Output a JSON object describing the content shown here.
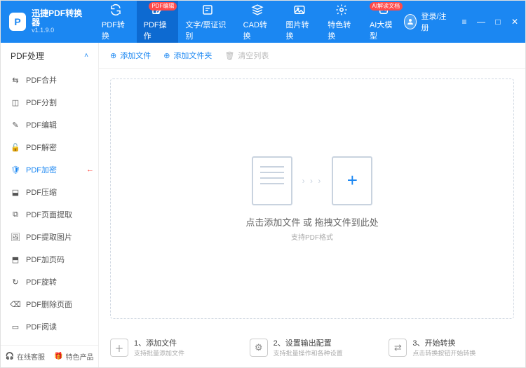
{
  "app": {
    "name": "迅捷PDF转换器",
    "version": "v1.1.9.0"
  },
  "header": {
    "tabs": [
      {
        "label": "PDF转换",
        "badge": ""
      },
      {
        "label": "PDF操作",
        "badge": "PDF编辑"
      },
      {
        "label": "文字/票证识别",
        "badge": ""
      },
      {
        "label": "CAD转换",
        "badge": ""
      },
      {
        "label": "图片转换",
        "badge": ""
      },
      {
        "label": "特色转换",
        "badge": ""
      },
      {
        "label": "AI大模型",
        "badge": "AI解读文档"
      }
    ],
    "login": "登录/注册"
  },
  "sidebar": {
    "header": "PDF处理",
    "items": [
      {
        "label": "PDF合并"
      },
      {
        "label": "PDF分割"
      },
      {
        "label": "PDF编辑"
      },
      {
        "label": "PDF解密"
      },
      {
        "label": "PDF加密"
      },
      {
        "label": "PDF压缩"
      },
      {
        "label": "PDF页面提取"
      },
      {
        "label": "PDF提取图片"
      },
      {
        "label": "PDF加页码"
      },
      {
        "label": "PDF旋转"
      },
      {
        "label": "PDF删除页面"
      },
      {
        "label": "PDF阅读"
      }
    ],
    "footer": {
      "support": "在线客服",
      "featured": "特色产品"
    }
  },
  "toolbar": {
    "add_file": "添加文件",
    "add_folder": "添加文件夹",
    "clear_list": "清空列表"
  },
  "dropzone": {
    "title": "点击添加文件 或 拖拽文件到此处",
    "subtitle": "支持PDF格式"
  },
  "steps": [
    {
      "title": "1、添加文件",
      "sub": "支持批量添加文件"
    },
    {
      "title": "2、设置输出配置",
      "sub": "支持批量操作和各种设置"
    },
    {
      "title": "3、开始转换",
      "sub": "点击转换按钮开始转换"
    }
  ]
}
